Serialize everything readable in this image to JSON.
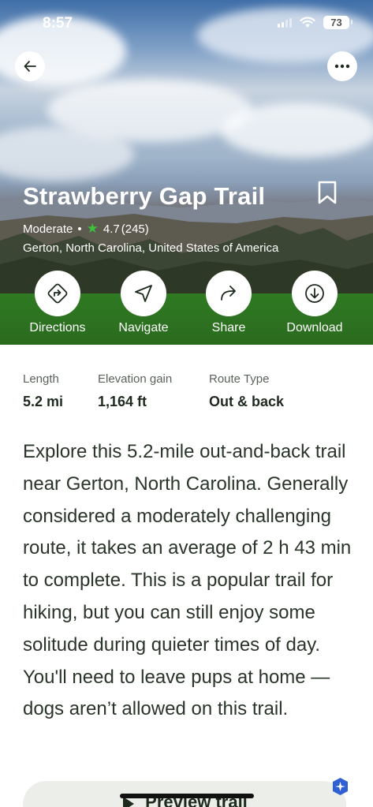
{
  "status_bar": {
    "time": "8:57",
    "battery": "73"
  },
  "trail": {
    "title": "Strawberry Gap Trail",
    "difficulty": "Moderate",
    "separator": "•",
    "rating": "4.7",
    "review_count": "(245)",
    "location": "Gerton, North Carolina, United States of America"
  },
  "actions": [
    {
      "label": "Directions",
      "icon": "directions-icon"
    },
    {
      "label": "Navigate",
      "icon": "navigate-icon"
    },
    {
      "label": "Share",
      "icon": "share-icon"
    },
    {
      "label": "Download",
      "icon": "download-icon"
    }
  ],
  "stats": [
    {
      "label": "Length",
      "value": "5.2 mi"
    },
    {
      "label": "Elevation gain",
      "value": "1,164 ft"
    },
    {
      "label": "Route Type",
      "value": "Out & back"
    }
  ],
  "description": "Explore this 5.2-mile out-and-back trail near Gerton, North Carolina. Generally considered a moderately challenging route, it takes an average of 2 h 43 min to complete. This is a popular trail for hiking, but you can still enjoy some solitude during quieter times of day. You'll need to leave pups at home — dogs aren’t allowed on this trail.",
  "preview_button": {
    "label": "Preview trail"
  },
  "colors": {
    "star": "#3cc13c",
    "grass": "#2f7a23",
    "text": "#2a352a"
  }
}
